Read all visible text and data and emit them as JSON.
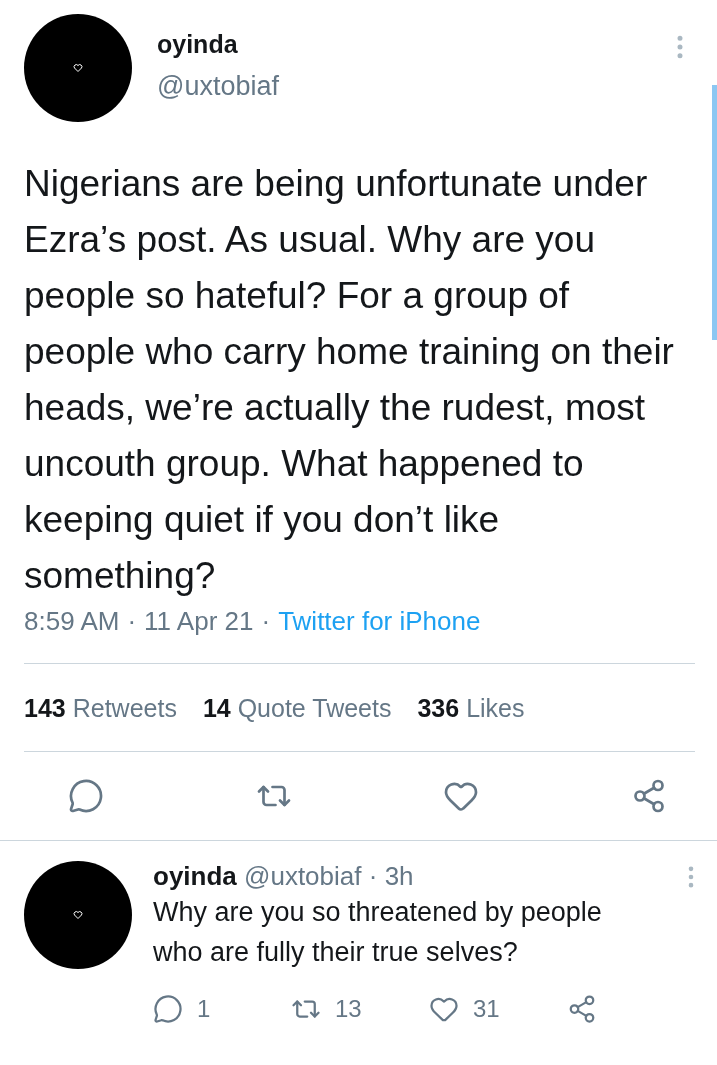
{
  "tweet": {
    "name": "oyinda",
    "handle": "@uxtobiaf",
    "text": "Nigerians are being unfortunate under Ezra’s post. As usual. Why are you people so hateful? For a group of people who carry home training on their heads, we’re actually the rudest, most uncouth group. What happened to keeping quiet if you don’t like something?",
    "time": "8:59 AM",
    "date": "11 Apr 21",
    "source": "Twitter for iPhone",
    "separator": "·",
    "stats": [
      {
        "count": "143",
        "label": "Retweets"
      },
      {
        "count": "14",
        "label": "Quote Tweets"
      },
      {
        "count": "336",
        "label": "Likes"
      }
    ]
  },
  "reply": {
    "name": "oyinda",
    "handle": "@uxtobiaf",
    "separator": "·",
    "age": "3h",
    "text": "Why are you so threatened by people who are fully their true selves?",
    "actions": [
      {
        "kind": "reply",
        "count": "1"
      },
      {
        "kind": "retweet",
        "count": "13"
      },
      {
        "kind": "like",
        "count": "31"
      },
      {
        "kind": "share"
      }
    ]
  }
}
